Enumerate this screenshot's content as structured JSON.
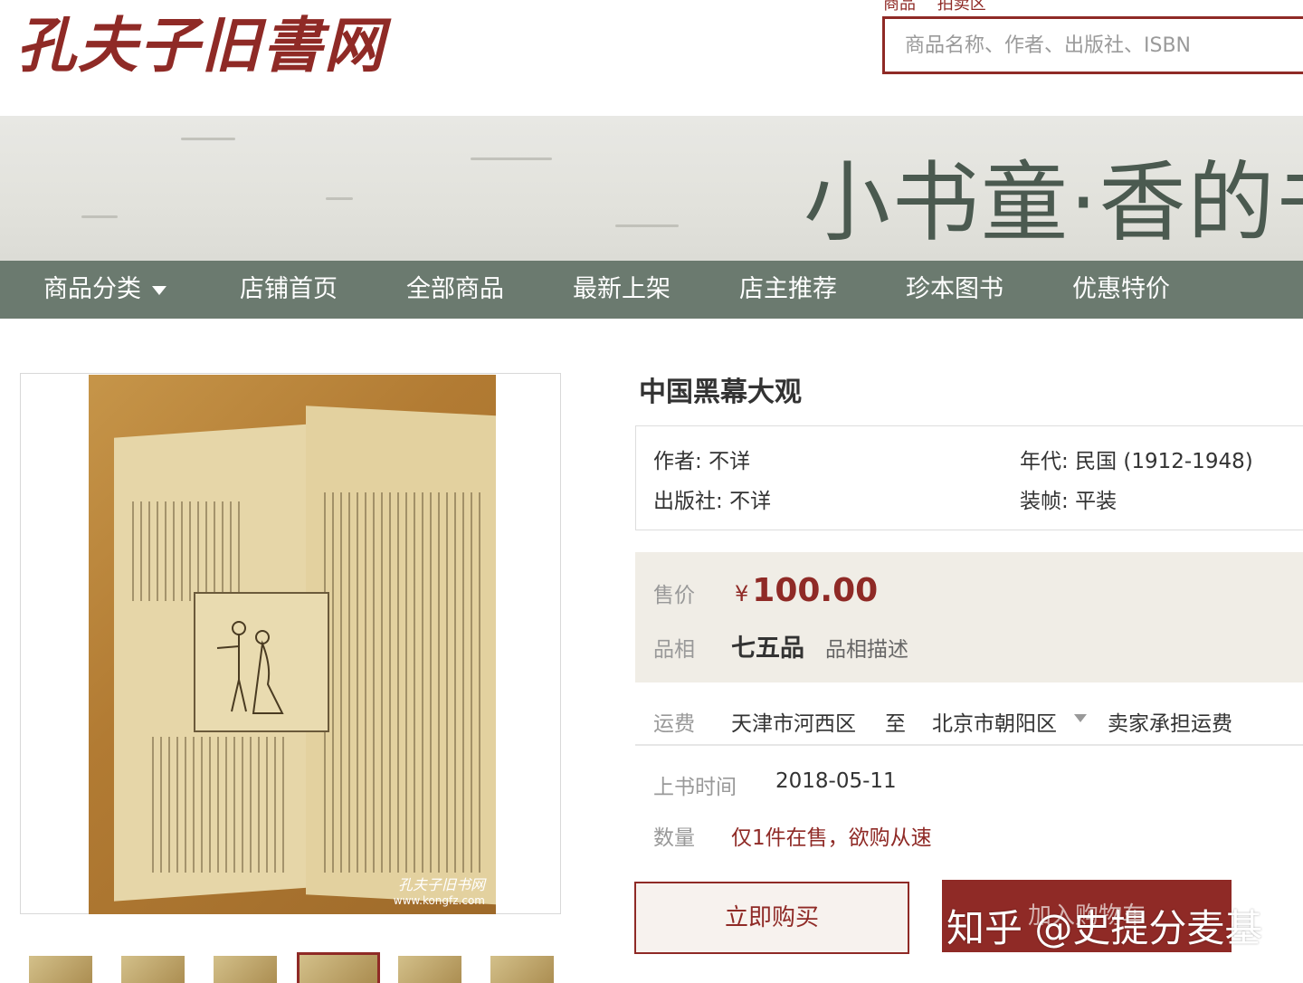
{
  "header": {
    "logo_text": "孔夫子旧書网",
    "search_tabs": [
      "商品",
      "拍卖区"
    ],
    "search_placeholder": "商品名称、作者、出版社、ISBN"
  },
  "banner": {
    "title": "小书童·香的书"
  },
  "nav": {
    "items": [
      {
        "label": "商品分类",
        "has_caret": true
      },
      {
        "label": "店铺首页"
      },
      {
        "label": "全部商品"
      },
      {
        "label": "最新上架"
      },
      {
        "label": "店主推荐"
      },
      {
        "label": "珍本图书"
      },
      {
        "label": "优惠特价"
      }
    ]
  },
  "image": {
    "watermark_logo": "孔夫子旧书网",
    "watermark_url": "www.kongfz.com"
  },
  "product": {
    "title": "中国黑幕大观",
    "author_label": "作者:",
    "author": "不详",
    "era_label": "年代:",
    "era": "民国 (1912-1948)",
    "publisher_label": "出版社:",
    "publisher": "不详",
    "binding_label": "装帧:",
    "binding": "平装",
    "price_label": "售价",
    "currency": "¥",
    "price": "100.00",
    "condition_label": "品相",
    "condition": "七五品",
    "condition_desc": "品相描述",
    "shipping_label": "运费",
    "ship_from": "天津市河西区",
    "ship_to_word": "至",
    "ship_to": "北京市朝阳区",
    "shipping_note": "卖家承担运费",
    "listed_label": "上书时间",
    "listed_date": "2018-05-11",
    "qty_label": "数量",
    "qty_text": "仅1件在售，欲购从速",
    "buy_button": "立即购买",
    "cart_button": "加入购物车"
  },
  "overlay_watermark": "知乎 @史提分麦基",
  "colors": {
    "brand": "#8f2a26",
    "nav_bg": "#6b7a6f",
    "banner_text": "#4b5a50",
    "price_bg": "#f0ede6"
  }
}
